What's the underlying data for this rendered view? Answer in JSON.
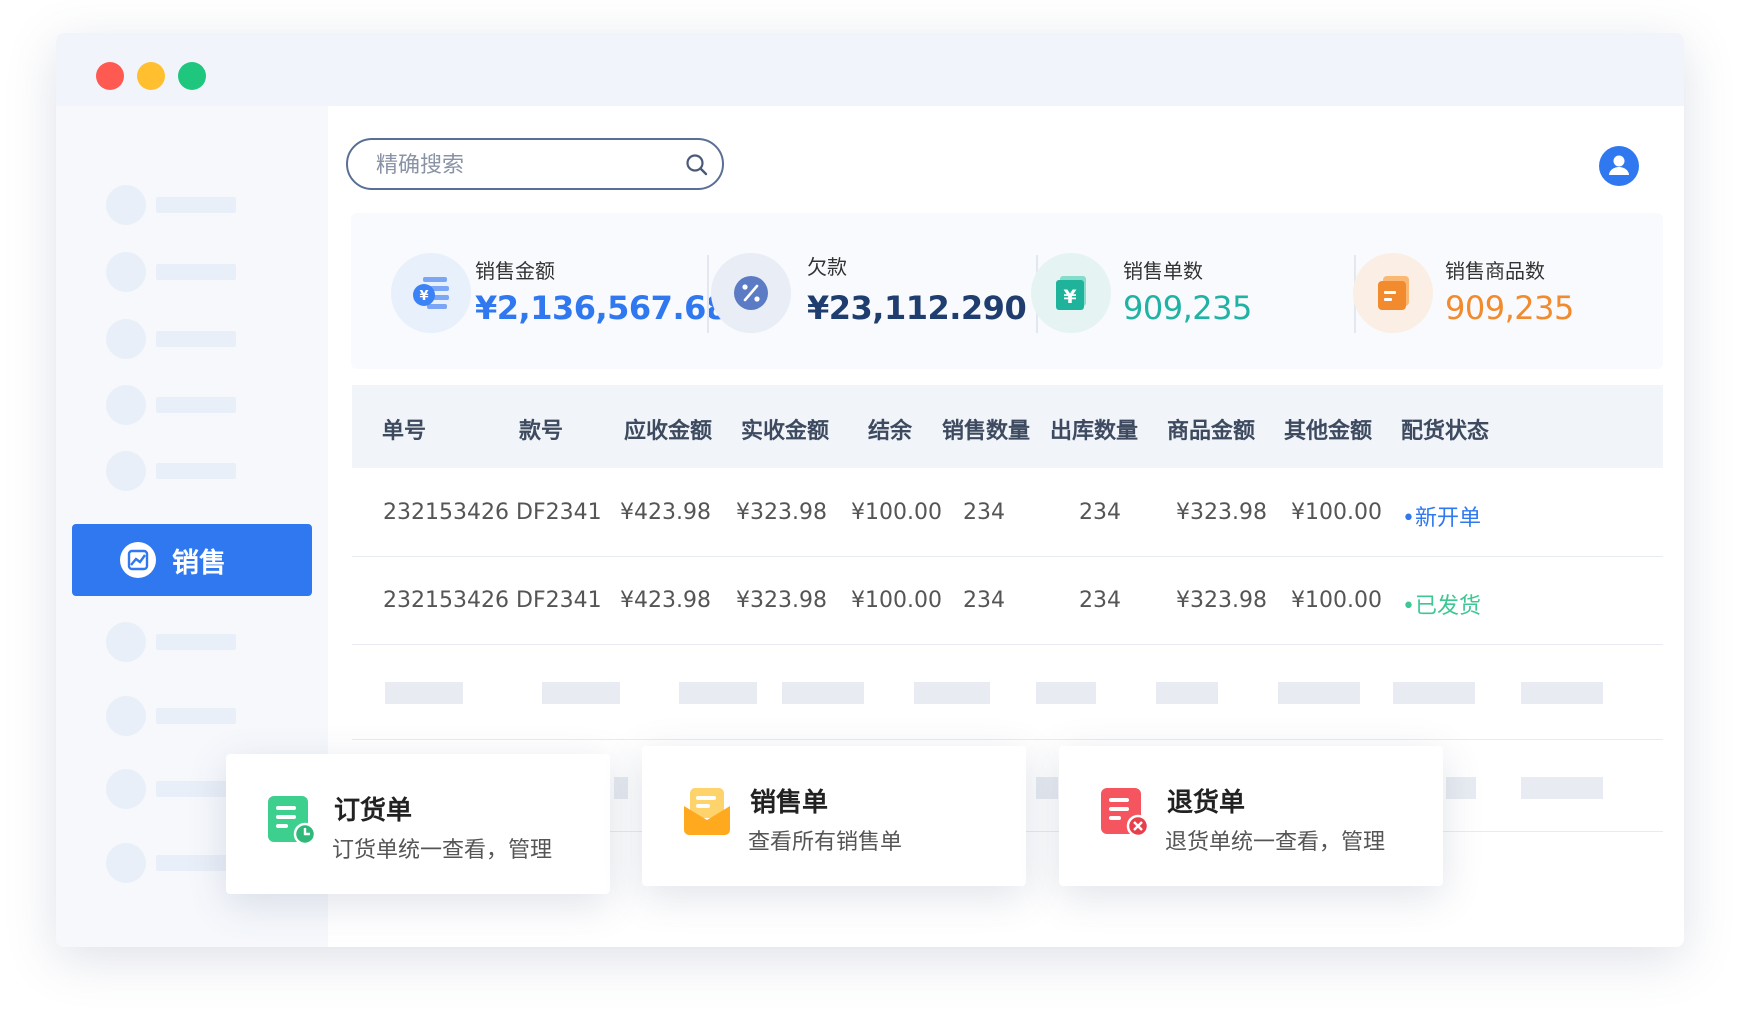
{
  "window": {
    "dots": {
      "red": "#ff5a52",
      "yellow": "#ffbf2f",
      "green": "#1fc77e"
    }
  },
  "sidebar": {
    "active_item": {
      "label": "销售",
      "icon": "chart-icon"
    }
  },
  "search": {
    "placeholder": "精确搜索",
    "value": ""
  },
  "stats": [
    {
      "title": "销售金额",
      "value": "¥2,136,567.68",
      "color": "#2f78f0",
      "icon": "coin-list-icon"
    },
    {
      "title": "欠款",
      "value": "¥23,112.290",
      "color": "#1f3d6e",
      "icon": "percent-icon"
    },
    {
      "title": "销售单数",
      "value": "909,235",
      "color": "#20b2a4",
      "icon": "yen-doc-icon"
    },
    {
      "title": "销售商品数",
      "value": "909,235",
      "color": "#f28a2e",
      "icon": "box-icon"
    }
  ],
  "table": {
    "headers": [
      "单号",
      "款号",
      "应收金额",
      "实收金额",
      "结余",
      "销售数量",
      "出库数量",
      "商品金额",
      "其他金额",
      "配货状态"
    ],
    "rows": [
      [
        "232153426",
        "DF2341",
        "¥423.98",
        "¥323.98",
        "¥100.00",
        "234",
        "234",
        "¥323.98",
        "¥100.00",
        "•新开单"
      ],
      [
        "232153426",
        "DF2341",
        "¥423.98",
        "¥323.98",
        "¥100.00",
        "234",
        "234",
        "¥323.98",
        "¥100.00",
        "•已发货"
      ]
    ],
    "status_colors": [
      "#2f78f0",
      "#3cc793"
    ]
  },
  "cards": [
    {
      "title": "订货单",
      "subtitle": "订货单统一查看，管理",
      "icon": "order-doc-icon",
      "color": "#3ccf8e"
    },
    {
      "title": "销售单",
      "subtitle": "查看所有销售单",
      "icon": "mail-icon",
      "color": "#ffb22e"
    },
    {
      "title": "退货单",
      "subtitle": "退货单统一查看，管理",
      "icon": "return-doc-icon",
      "color": "#f5555f"
    }
  ]
}
